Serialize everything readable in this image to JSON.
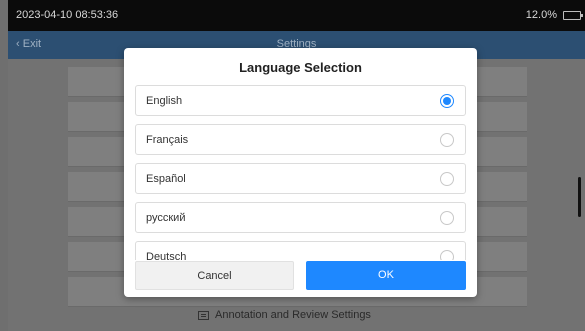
{
  "status_bar": {
    "datetime": "2023-04-10 08:53:36",
    "battery_text": "12.0%"
  },
  "top_bar": {
    "back_label": "Exit",
    "title": "Settings"
  },
  "background": {
    "footer_link_label": "Annotation and Review Settings"
  },
  "dialog": {
    "title": "Language Selection",
    "options": [
      {
        "label": "English",
        "selected": true
      },
      {
        "label": "Français",
        "selected": false
      },
      {
        "label": "Español",
        "selected": false
      },
      {
        "label": "русский",
        "selected": false
      },
      {
        "label": "Deutsch",
        "selected": false
      }
    ],
    "cancel_label": "Cancel",
    "ok_label": "OK",
    "accent_color": "#1e88ff"
  }
}
